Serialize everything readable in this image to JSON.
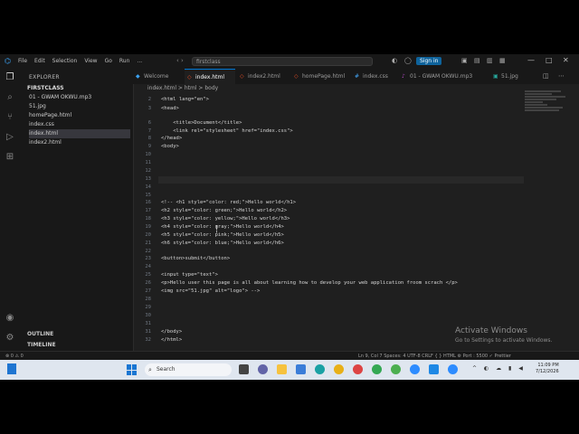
{
  "titlebar": {
    "menu": [
      "File",
      "Edit",
      "Selection",
      "View",
      "Go",
      "Run",
      "..."
    ],
    "search": "firstclass",
    "signin": "Sign in"
  },
  "sidebar": {
    "header": "EXPLORER",
    "folder": "FIRSTCLASS",
    "files": [
      "01 - GWAM OKWU.mp3",
      "51.jpg",
      "homePage.html",
      "index.css",
      "index.html",
      "index2.html"
    ],
    "active_index": 4,
    "outline": "OUTLINE",
    "timeline": "TIMELINE"
  },
  "tabs": [
    "Welcome",
    "index.html",
    "index2.html",
    "homePage.html",
    "index.css",
    "01 - GWAM OKWU.mp3",
    "51.jpg"
  ],
  "active_tab": 1,
  "breadcrumb": "index.html > html > body",
  "code_lines": [
    {
      "n": "2",
      "text": "<html lang=\"en\">"
    },
    {
      "n": "3",
      "text": "<head>"
    },
    {
      "n": "6",
      "text": "    <title>Document</title>"
    },
    {
      "n": "7",
      "text": "    <link rel=\"stylesheet\" href=\"index.css\">"
    },
    {
      "n": "8",
      "text": "</head>"
    },
    {
      "n": "9",
      "text": "<body>"
    },
    {
      "n": "10",
      "text": ""
    },
    {
      "n": "11",
      "text": ""
    },
    {
      "n": "12",
      "text": ""
    },
    {
      "n": "13",
      "text": ""
    },
    {
      "n": "14",
      "text": ""
    },
    {
      "n": "15",
      "text": ""
    },
    {
      "n": "16",
      "text": "<!-- <h1 style=\"color: red;\">Hello world</h1>"
    },
    {
      "n": "17",
      "text": "<h2 style=\"color: green;\">Hello world</h2>"
    },
    {
      "n": "18",
      "text": "<h3 style=\"color: yellow;\">Hello world</h3>"
    },
    {
      "n": "19",
      "text": "<h4 style=\"color: gray;\">Hello world</h4>"
    },
    {
      "n": "20",
      "text": "<h5 style=\"color: pink;\">Hello world</h5>"
    },
    {
      "n": "21",
      "text": "<h6 style=\"color: blue;\">Hello world</h6>"
    },
    {
      "n": "22",
      "text": ""
    },
    {
      "n": "23",
      "text": "<button>submit</button>"
    },
    {
      "n": "24",
      "text": ""
    },
    {
      "n": "25",
      "text": "<input type=\"text\">"
    },
    {
      "n": "26",
      "text": "<p>Hello user this page is all about learning how to develop your web application froom scrach </p>"
    },
    {
      "n": "27",
      "text": "<img src=\"51.jpg\" alt=\"logo\"> -->"
    },
    {
      "n": "28",
      "text": ""
    },
    {
      "n": "29",
      "text": ""
    },
    {
      "n": "30",
      "text": ""
    },
    {
      "n": "31",
      "text": ""
    },
    {
      "n": "31b",
      "text": "</body>"
    },
    {
      "n": "32",
      "text": "</html>"
    }
  ],
  "watermark": {
    "title": "Activate Windows",
    "subtitle": "Go to Settings to activate Windows."
  },
  "status": {
    "left": "⊗ 0 ⚠ 0",
    "right": "Ln 9, Col 7   Spaces: 4   UTF-8   CRLF   { } HTML   ⚙ Port : 5500   ✓ Prettier"
  },
  "taskbar": {
    "search": "Search",
    "time": "11:09 PM",
    "date": "7/12/2026"
  }
}
